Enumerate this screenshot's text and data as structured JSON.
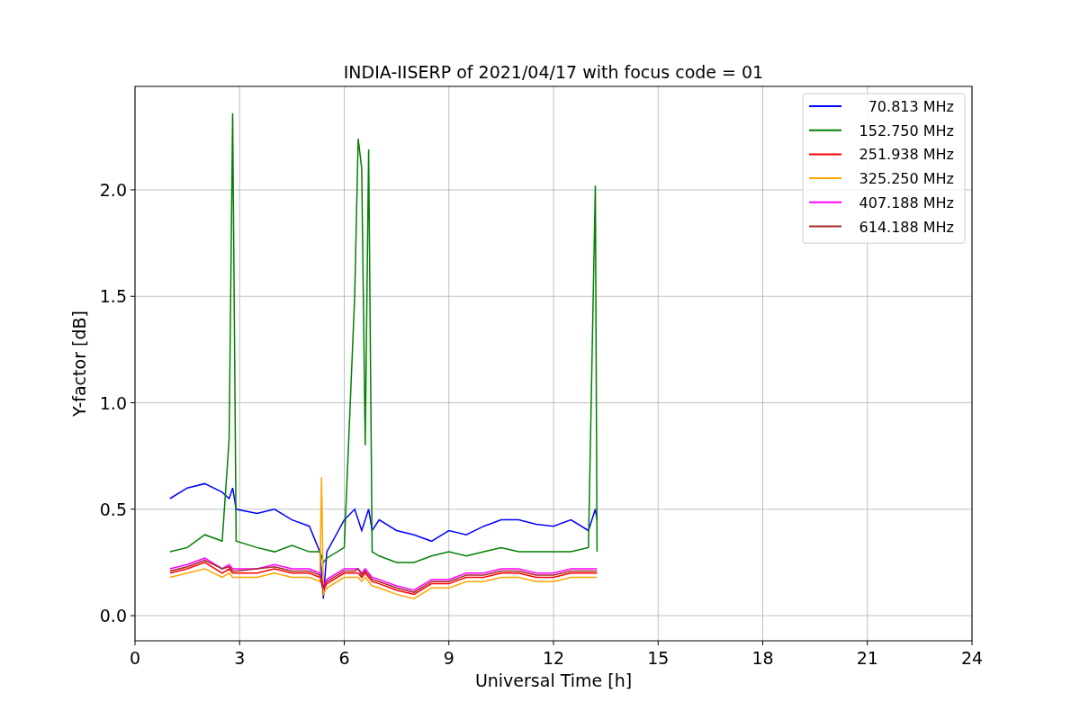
{
  "figure": {
    "chart_data": {
      "type": "line",
      "title": "INDIA-IISERP of 2021/04/17 with focus code = 01",
      "xlabel": "Universal Time [h]",
      "ylabel": "Y-factor [dB]",
      "grid": true,
      "legend": true,
      "xlim": [
        0,
        24
      ],
      "ylim": [
        -0.118,
        2.486
      ],
      "xticks": [
        0,
        3,
        6,
        9,
        12,
        15,
        18,
        21,
        24
      ],
      "yticks": [
        {
          "value": 0,
          "label": "0.0"
        },
        {
          "value": 0.5,
          "label": "0.5"
        },
        {
          "value": 1,
          "label": "1.0"
        },
        {
          "value": 1.5,
          "label": "1.5"
        },
        {
          "value": 2,
          "label": "2.0"
        }
      ],
      "x": [
        1,
        1.5,
        2,
        2.5,
        2.7,
        2.8,
        2.9,
        3.5,
        4,
        4.5,
        5,
        5.3,
        5.35,
        5.4,
        5.5,
        6,
        6.3,
        6.4,
        6.5,
        6.6,
        6.7,
        6.8,
        7,
        7.5,
        8,
        8.5,
        9,
        9.5,
        10,
        10.5,
        11,
        11.5,
        12,
        12.5,
        13,
        13.2,
        13.25
      ],
      "series": [
        {
          "name": "70.813 MHz",
          "color": "#0000ff",
          "values": [
            0.55,
            0.6,
            0.62,
            0.58,
            0.55,
            0.6,
            0.5,
            0.48,
            0.5,
            0.45,
            0.42,
            0.3,
            0.2,
            0.08,
            0.3,
            0.45,
            0.5,
            0.45,
            0.4,
            0.45,
            0.5,
            0.4,
            0.45,
            0.4,
            0.38,
            0.35,
            0.4,
            0.38,
            0.42,
            0.45,
            0.45,
            0.43,
            0.42,
            0.45,
            0.4,
            0.5,
            0.45
          ]
        },
        {
          "name": "152.750 MHz",
          "color": "#008000",
          "values": [
            0.3,
            0.32,
            0.38,
            0.35,
            0.83,
            2.36,
            0.35,
            0.32,
            0.3,
            0.33,
            0.3,
            0.3,
            0.28,
            0.25,
            0.27,
            0.32,
            1.5,
            2.24,
            2.1,
            0.8,
            2.19,
            0.3,
            0.28,
            0.25,
            0.25,
            0.28,
            0.3,
            0.28,
            0.3,
            0.32,
            0.3,
            0.3,
            0.3,
            0.3,
            0.32,
            2.02,
            0.3
          ]
        },
        {
          "name": "251.938 MHz",
          "color": "#ff0000",
          "values": [
            0.2,
            0.22,
            0.25,
            0.2,
            0.22,
            0.2,
            0.2,
            0.2,
            0.22,
            0.2,
            0.2,
            0.18,
            0.15,
            0.12,
            0.15,
            0.2,
            0.2,
            0.2,
            0.18,
            0.2,
            0.18,
            0.16,
            0.15,
            0.12,
            0.1,
            0.15,
            0.15,
            0.18,
            0.18,
            0.2,
            0.2,
            0.18,
            0.18,
            0.2,
            0.2,
            0.2,
            0.2
          ]
        },
        {
          "name": "325.250 MHz",
          "color": "#ffa500",
          "values": [
            0.18,
            0.2,
            0.22,
            0.18,
            0.2,
            0.18,
            0.18,
            0.18,
            0.2,
            0.18,
            0.18,
            0.16,
            0.65,
            0.1,
            0.13,
            0.18,
            0.18,
            0.18,
            0.16,
            0.18,
            0.16,
            0.14,
            0.13,
            0.1,
            0.08,
            0.13,
            0.13,
            0.16,
            0.16,
            0.18,
            0.18,
            0.16,
            0.16,
            0.18,
            0.18,
            0.18,
            0.18
          ]
        },
        {
          "name": "407.188 MHz",
          "color": "#ff00ff",
          "values": [
            0.22,
            0.24,
            0.27,
            0.22,
            0.24,
            0.22,
            0.22,
            0.22,
            0.24,
            0.22,
            0.22,
            0.2,
            0.17,
            0.14,
            0.17,
            0.22,
            0.22,
            0.22,
            0.2,
            0.22,
            0.2,
            0.18,
            0.17,
            0.14,
            0.12,
            0.17,
            0.17,
            0.2,
            0.2,
            0.22,
            0.22,
            0.2,
            0.2,
            0.22,
            0.22,
            0.22,
            0.22
          ]
        },
        {
          "name": "614.188 MHz",
          "color": "#a52a2a",
          "values": [
            0.21,
            0.23,
            0.26,
            0.22,
            0.23,
            0.21,
            0.21,
            0.22,
            0.23,
            0.21,
            0.21,
            0.19,
            0.16,
            0.13,
            0.16,
            0.21,
            0.21,
            0.22,
            0.19,
            0.21,
            0.19,
            0.17,
            0.16,
            0.13,
            0.11,
            0.16,
            0.16,
            0.19,
            0.19,
            0.21,
            0.21,
            0.19,
            0.19,
            0.21,
            0.21,
            0.21,
            0.21
          ]
        }
      ]
    }
  }
}
